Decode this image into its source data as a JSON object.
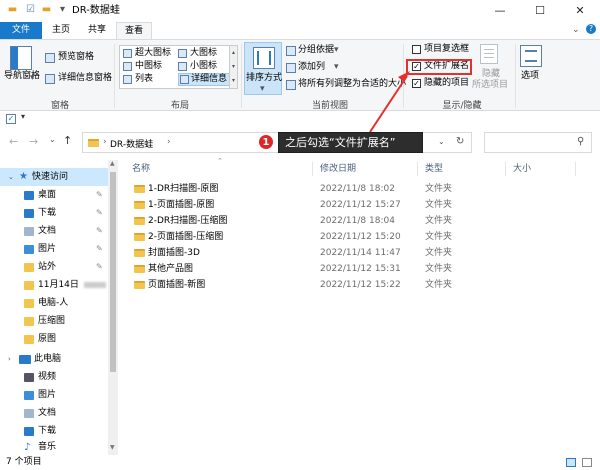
{
  "window": {
    "title": "DR-数据蛙",
    "minimize_glyph": "—",
    "maximize_glyph": "☐",
    "close_glyph": "✕"
  },
  "tabs": [
    {
      "label": "文件"
    },
    {
      "label": "主页"
    },
    {
      "label": "共享"
    },
    {
      "label": "查看"
    }
  ],
  "ribbon": {
    "panes": {
      "nav_pane": "导航窗格",
      "preview_pane": "预览窗格",
      "details_pane": "详细信息窗格",
      "label": "窗格"
    },
    "layout": {
      "items": [
        "超大图标",
        "大图标",
        "中图标",
        "小图标",
        "列表",
        "详细信息"
      ],
      "label": "布局"
    },
    "current_view": {
      "sort_by": "排序方式",
      "group_by": "分组依据",
      "add_column": "添加列",
      "fit_columns": "将所有列调整为合适的大小",
      "label": "当前视图"
    },
    "show_hide": {
      "item_checkboxes": "项目复选框",
      "file_extensions": "文件扩展名",
      "hidden_items": "隐藏的项目",
      "hide_selected_line1": "隐藏",
      "hide_selected_line2": "所选项目",
      "label": "显示/隐藏",
      "item_checkboxes_checked": false,
      "file_extensions_checked": true,
      "hidden_items_checked": true
    },
    "options": "选项"
  },
  "address": {
    "path": "DR-数据蛙",
    "search_placeholder": ""
  },
  "annotation": {
    "number": "1",
    "text": "之后勾选“文件扩展名”"
  },
  "nav": {
    "quick_access": "快速访问",
    "items": [
      {
        "label": "桌面",
        "pinned": true
      },
      {
        "label": "下载",
        "pinned": true
      },
      {
        "label": "文档",
        "pinned": true
      },
      {
        "label": "图片",
        "pinned": true
      },
      {
        "label": "站外",
        "pinned": true
      },
      {
        "label": "11月14日",
        "pinned": false
      },
      {
        "label": "电脑-人",
        "pinned": false
      },
      {
        "label": "压缩图",
        "pinned": false
      },
      {
        "label": "原图",
        "pinned": false
      }
    ],
    "this_pc": "此电脑",
    "pc_items": [
      {
        "label": "视频"
      },
      {
        "label": "图片"
      },
      {
        "label": "文档"
      },
      {
        "label": "下载"
      },
      {
        "label": "音乐"
      }
    ],
    "pin_glyph": "📌"
  },
  "columns": {
    "name": "名称",
    "date": "修改日期",
    "type": "类型",
    "size": "大小"
  },
  "files": [
    {
      "name": "1-DR扫描图-原图",
      "date": "2022/11/8 18:02",
      "type": "文件夹"
    },
    {
      "name": "1-页面插图-原图",
      "date": "2022/11/12 15:27",
      "type": "文件夹"
    },
    {
      "name": "2-DR扫描图-压缩图",
      "date": "2022/11/8 18:04",
      "type": "文件夹"
    },
    {
      "name": "2-页面插图-压缩图",
      "date": "2022/11/12 15:20",
      "type": "文件夹"
    },
    {
      "name": "封面插图-3D",
      "date": "2022/11/14 11:47",
      "type": "文件夹"
    },
    {
      "name": "其他产品图",
      "date": "2022/11/12 15:31",
      "type": "文件夹"
    },
    {
      "name": "页面插图-新图",
      "date": "2022/11/12 15:22",
      "type": "文件夹"
    }
  ],
  "status": {
    "count": "7 个项目"
  },
  "colors": {
    "accent": "#1979ca",
    "folder": "#f1c54e",
    "annotation_red": "#e53030"
  }
}
